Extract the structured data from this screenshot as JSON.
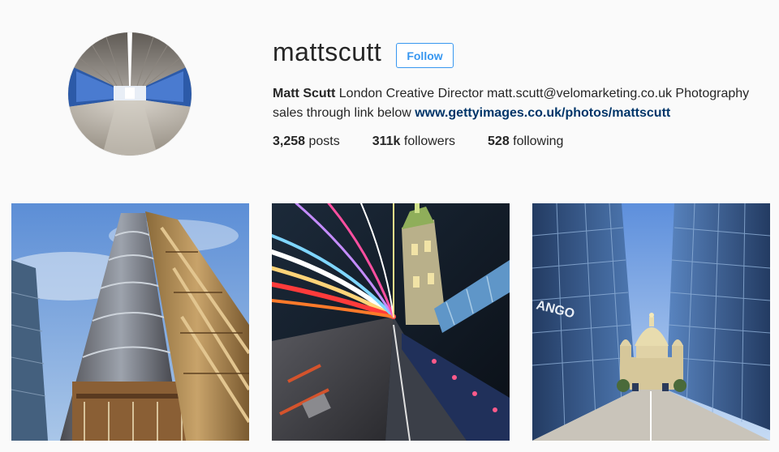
{
  "profile": {
    "username": "mattscutt",
    "follow_label": "Follow",
    "full_name": "Matt Scutt",
    "bio_text": " London Creative Director matt.scutt@velomarketing.co.uk Photography sales through link below ",
    "link_text": "www.gettyimages.co.uk/photos/mattscutt",
    "avatar_alt": "profile-photo-tunnel"
  },
  "stats": {
    "posts_count": "3,258",
    "posts_label": " posts",
    "followers_count": "311k",
    "followers_label": " followers",
    "following_count": "528",
    "following_label": " following"
  },
  "posts": [
    {
      "subject": "lloyds-building-looking-up"
    },
    {
      "subject": "tower-bridge-light-trails"
    },
    {
      "subject": "st-pauls-reflection-glass-buildings"
    }
  ],
  "colors": {
    "accent": "#3897f0",
    "link": "#003569",
    "text": "#262626",
    "background": "#fafafa"
  }
}
